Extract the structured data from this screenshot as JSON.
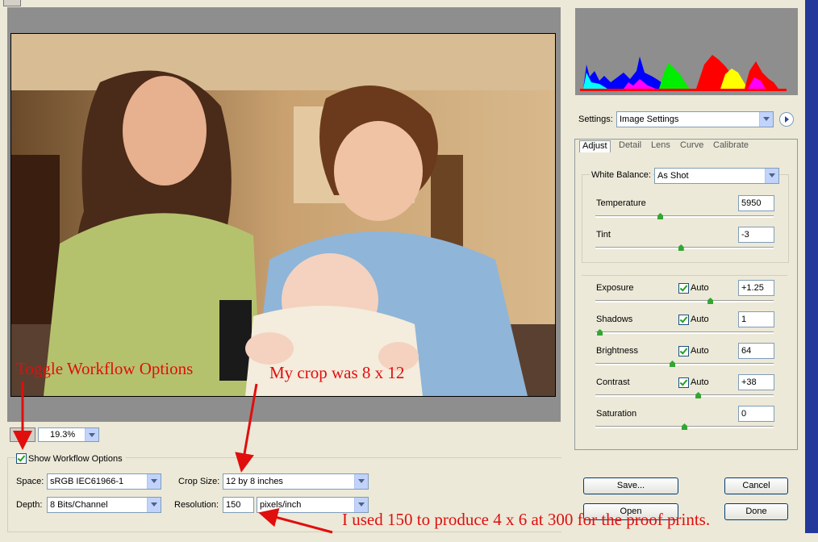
{
  "zoom": {
    "value": "19.3%"
  },
  "workflow": {
    "toggle_label": "Show Workflow Options",
    "toggle_checked": true,
    "space_label": "Space:",
    "space_value": "sRGB IEC61966-1",
    "depth_label": "Depth:",
    "depth_value": "8 Bits/Channel",
    "crop_label": "Crop Size:",
    "crop_value": "12 by 8 inches",
    "resolution_label": "Resolution:",
    "resolution_value": "150",
    "resolution_unit": "pixels/inch"
  },
  "settings": {
    "label": "Settings:",
    "value": "Image Settings"
  },
  "tabs": [
    "Adjust",
    "Detail",
    "Lens",
    "Curve",
    "Calibrate"
  ],
  "active_tab": "Adjust",
  "white_balance": {
    "label": "White Balance:",
    "value": "As Shot"
  },
  "adjust": [
    {
      "label": "Temperature",
      "value": "5950",
      "auto": false,
      "level": 0.36
    },
    {
      "label": "Tint",
      "value": "-3",
      "auto": false,
      "level": 0.48
    },
    {
      "label": "Exposure",
      "value": "+1.25",
      "auto": true,
      "auto_label": "Auto",
      "level": 0.65
    },
    {
      "label": "Shadows",
      "value": "1",
      "auto": true,
      "auto_label": "Auto",
      "level": 0.01
    },
    {
      "label": "Brightness",
      "value": "64",
      "auto": true,
      "auto_label": "Auto",
      "level": 0.43
    },
    {
      "label": "Contrast",
      "value": "+38",
      "auto": true,
      "auto_label": "Auto",
      "level": 0.58
    },
    {
      "label": "Saturation",
      "value": "0",
      "auto": false,
      "level": 0.5
    }
  ],
  "buttons": {
    "save": "Save...",
    "cancel": "Cancel",
    "open": "Open",
    "done": "Done"
  },
  "annotations": {
    "toggle": "Toggle Workflow Options",
    "crop": "My crop was 8 x 12",
    "resolution": "I used 150 to produce 4 x 6 at 300 for the proof prints."
  },
  "colors": {
    "annotation": "#e10e0e",
    "window_bg": "#ece9d8",
    "accent": "#33a533"
  }
}
